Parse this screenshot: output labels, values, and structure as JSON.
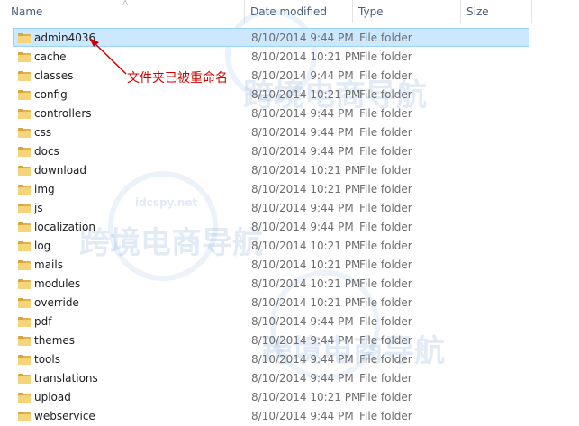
{
  "columns": {
    "name": "Name",
    "date": "Date modified",
    "type": "Type",
    "size": "Size"
  },
  "files": [
    {
      "name": "admin4036",
      "date": "8/10/2014 9:44 PM",
      "type": "File folder",
      "selected": true
    },
    {
      "name": "cache",
      "date": "8/10/2014 10:21 PM",
      "type": "File folder"
    },
    {
      "name": "classes",
      "date": "8/10/2014 9:44 PM",
      "type": "File folder"
    },
    {
      "name": "config",
      "date": "8/10/2014 10:21 PM",
      "type": "File folder"
    },
    {
      "name": "controllers",
      "date": "8/10/2014 9:44 PM",
      "type": "File folder"
    },
    {
      "name": "css",
      "date": "8/10/2014 9:44 PM",
      "type": "File folder"
    },
    {
      "name": "docs",
      "date": "8/10/2014 9:44 PM",
      "type": "File folder"
    },
    {
      "name": "download",
      "date": "8/10/2014 10:21 PM",
      "type": "File folder"
    },
    {
      "name": "img",
      "date": "8/10/2014 10:21 PM",
      "type": "File folder"
    },
    {
      "name": "js",
      "date": "8/10/2014 9:44 PM",
      "type": "File folder"
    },
    {
      "name": "localization",
      "date": "8/10/2014 9:44 PM",
      "type": "File folder"
    },
    {
      "name": "log",
      "date": "8/10/2014 10:21 PM",
      "type": "File folder"
    },
    {
      "name": "mails",
      "date": "8/10/2014 10:21 PM",
      "type": "File folder"
    },
    {
      "name": "modules",
      "date": "8/10/2014 10:21 PM",
      "type": "File folder"
    },
    {
      "name": "override",
      "date": "8/10/2014 10:21 PM",
      "type": "File folder"
    },
    {
      "name": "pdf",
      "date": "8/10/2014 9:44 PM",
      "type": "File folder"
    },
    {
      "name": "themes",
      "date": "8/10/2014 9:44 PM",
      "type": "File folder"
    },
    {
      "name": "tools",
      "date": "8/10/2014 9:44 PM",
      "type": "File folder"
    },
    {
      "name": "translations",
      "date": "8/10/2014 9:44 PM",
      "type": "File folder"
    },
    {
      "name": "upload",
      "date": "8/10/2014 10:21 PM",
      "type": "File folder"
    },
    {
      "name": "webservice",
      "date": "8/10/2014 9:44 PM",
      "type": "File folder"
    }
  ],
  "annotation": {
    "text": "文件夹已被重命名",
    "color": "#d10000"
  },
  "watermark": {
    "text": "跨境电商导航",
    "sub": "idcspy.net"
  },
  "colors": {
    "selection_bg": "#cce8ff",
    "selection_border": "#99d1ff",
    "folder": "#f6d57a",
    "header_text": "#4c607a"
  }
}
